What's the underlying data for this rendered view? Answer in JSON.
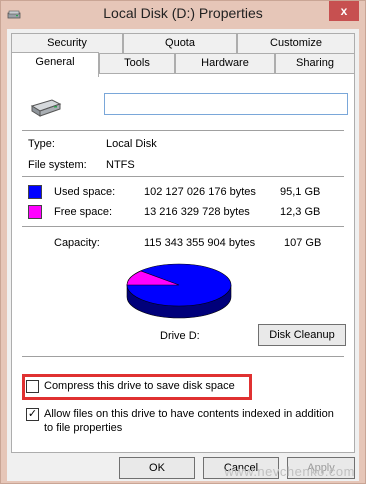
{
  "window": {
    "title": "Local Disk (D:) Properties",
    "close_glyph": "x"
  },
  "tabs_row1": [
    "Security",
    "Quota",
    "Customize"
  ],
  "tabs_row2": [
    "General",
    "Tools",
    "Hardware",
    "Sharing"
  ],
  "general": {
    "drive_name_value": "",
    "type_label": "Type:",
    "type_value": "Local Disk",
    "fs_label": "File system:",
    "fs_value": "NTFS",
    "used_label": "Used space:",
    "used_bytes": "102 127 026 176 bytes",
    "used_gb": "95,1 GB",
    "free_label": "Free space:",
    "free_bytes": "13 216 329 728 bytes",
    "free_gb": "12,3 GB",
    "capacity_label": "Capacity:",
    "capacity_bytes": "115 343 355 904 bytes",
    "capacity_gb": "107 GB",
    "drive_label": "Drive D:",
    "cleanup_button": "Disk Cleanup",
    "compress_label": "Compress this drive to save disk space",
    "compress_checked": false,
    "index_label": "Allow files on this drive to have contents indexed in addition to file properties",
    "index_checked": true
  },
  "colors": {
    "used": "#0000ff",
    "free": "#ff00ff",
    "highlight": "#e03131"
  },
  "buttons": {
    "ok": "OK",
    "cancel": "Cancel",
    "apply": "Apply"
  },
  "watermark": "www.nevchenko.com"
}
